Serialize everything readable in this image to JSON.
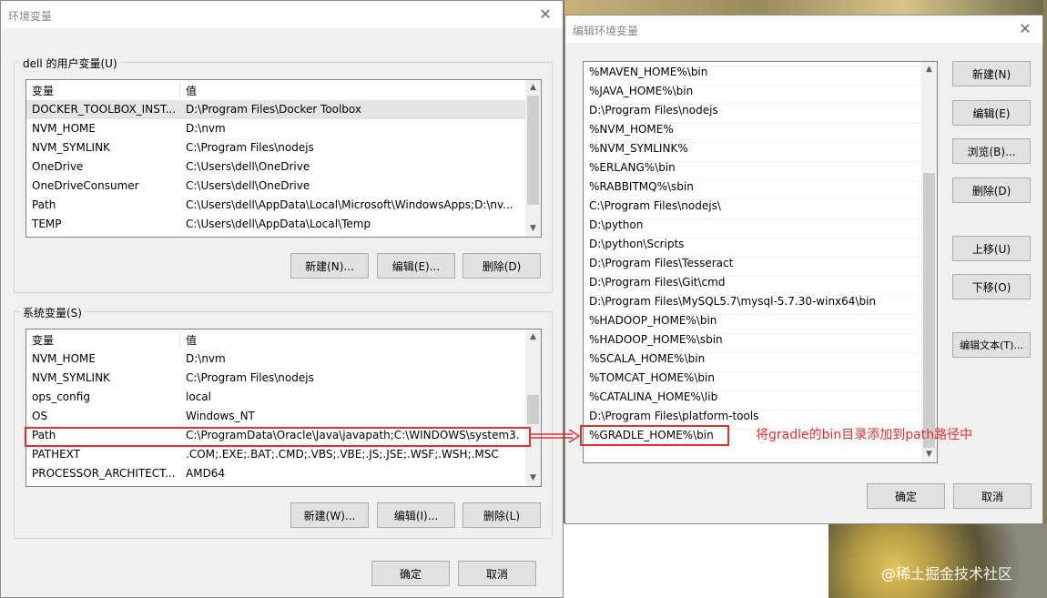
{
  "env_window": {
    "title": "环境变量",
    "user_vars": {
      "group_label": "dell 的用户变量(U)",
      "col_variable": "变量",
      "col_value": "值",
      "rows": [
        {
          "name": "DOCKER_TOOLBOX_INST...",
          "value": "D:\\Program Files\\Docker Toolbox"
        },
        {
          "name": "NVM_HOME",
          "value": "D:\\nvm"
        },
        {
          "name": "NVM_SYMLINK",
          "value": "C:\\Program Files\\nodejs"
        },
        {
          "name": "OneDrive",
          "value": "C:\\Users\\dell\\OneDrive"
        },
        {
          "name": "OneDriveConsumer",
          "value": "C:\\Users\\dell\\OneDrive"
        },
        {
          "name": "Path",
          "value": "C:\\Users\\dell\\AppData\\Local\\Microsoft\\WindowsApps;D:\\nv..."
        },
        {
          "name": "TEMP",
          "value": "C:\\Users\\dell\\AppData\\Local\\Temp"
        }
      ],
      "new_label": "新建(N)...",
      "edit_label": "编辑(E)...",
      "delete_label": "删除(D)"
    },
    "system_vars": {
      "group_label": "系统变量(S)",
      "col_variable": "变量",
      "col_value": "值",
      "rows": [
        {
          "name": "NVM_HOME",
          "value": "D:\\nvm"
        },
        {
          "name": "NVM_SYMLINK",
          "value": "C:\\Program Files\\nodejs"
        },
        {
          "name": "ops_config",
          "value": "local"
        },
        {
          "name": "OS",
          "value": "Windows_NT"
        },
        {
          "name": "Path",
          "value": "C:\\ProgramData\\Oracle\\Java\\javapath;C:\\WINDOWS\\system3..."
        },
        {
          "name": "PATHEXT",
          "value": ".COM;.EXE;.BAT;.CMD;.VBS;.VBE;.JS;.JSE;.WSF;.WSH;.MSC"
        },
        {
          "name": "PROCESSOR_ARCHITECT...",
          "value": "AMD64"
        }
      ],
      "new_label": "新建(W)...",
      "edit_label": "编辑(I)...",
      "delete_label": "删除(L)"
    },
    "ok_label": "确定",
    "cancel_label": "取消"
  },
  "edit_window": {
    "title": "编辑环境变量",
    "paths": [
      "%MAVEN_HOME%\\bin",
      "%JAVA_HOME%\\bin",
      "D:\\Program Files\\nodejs",
      "%NVM_HOME%",
      "%NVM_SYMLINK%",
      "%ERLANG%\\bin",
      "%RABBITMQ%\\sbin",
      "C:\\Program Files\\nodejs\\",
      "D:\\python",
      "D:\\python\\Scripts",
      "D:\\Program Files\\Tesseract",
      "D:\\Program Files\\Git\\cmd",
      "D:\\Program Files\\MySQL5.7\\mysql-5.7.30-winx64\\bin",
      "%HADOOP_HOME%\\bin",
      "%HADOOP_HOME%\\sbin",
      "%SCALA_HOME%\\bin",
      "%TOMCAT_HOME%\\bin",
      "%CATALINA_HOME%\\lib",
      "D:\\Program Files\\platform-tools",
      "%GRADLE_HOME%\\bin"
    ],
    "buttons": {
      "new": "新建(N)",
      "edit": "编辑(E)",
      "browse": "浏览(B)...",
      "delete": "删除(D)",
      "move_up": "上移(U)",
      "move_down": "下移(O)",
      "edit_text": "编辑文本(T)..."
    },
    "ok_label": "确定",
    "cancel_label": "取消"
  },
  "annotation": {
    "text": "将gradle的bin目录添加到path路径中",
    "color": "#e0302e"
  },
  "watermark": "@稀土掘金技术社区"
}
